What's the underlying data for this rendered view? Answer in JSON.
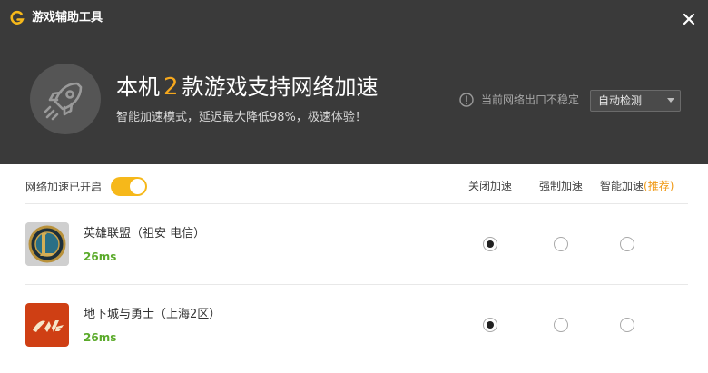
{
  "app": {
    "title": "游戏辅助工具"
  },
  "header": {
    "headline_prefix": "本机",
    "game_count": "2",
    "headline_suffix": "款游戏支持网络加速",
    "subline": "智能加速模式，延迟最大降低98%，极速体验！",
    "warning": "当前网络出口不稳定",
    "detect_select": "自动检测"
  },
  "controls": {
    "toggle_label": "网络加速已开启",
    "toggle_on": true,
    "columns": {
      "off": "关闭加速",
      "force": "强制加速",
      "smart": "智能加速",
      "smart_tag": "(推荐)"
    }
  },
  "games": [
    {
      "name": "英雄联盟（祖安 电信）",
      "ping": "26ms",
      "icon": "league-of-legends-icon",
      "mode": "off"
    },
    {
      "name": "地下城与勇士（上海2区）",
      "ping": "26ms",
      "icon": "dnf-icon",
      "mode": "off"
    }
  ],
  "colors": {
    "header_bg": "#3a3a3a",
    "accent": "#f6a81d",
    "ping_green": "#5aaa2a",
    "toggle": "#f6b81a"
  }
}
